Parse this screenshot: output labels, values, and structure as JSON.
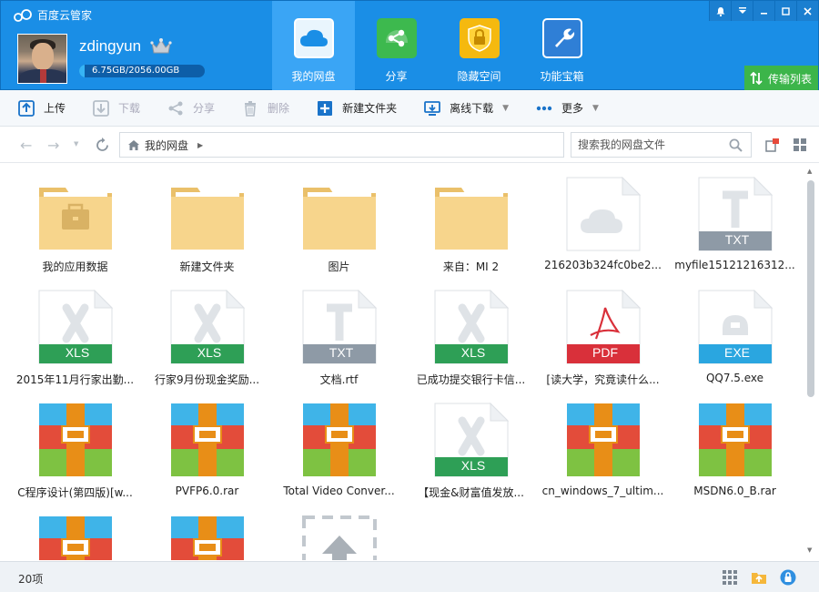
{
  "app": {
    "title": "百度云管家"
  },
  "user": {
    "name": "zdingyun",
    "quota_text": "6.75GB/2056.00GB",
    "quota_fraction": 0.0033
  },
  "nav": [
    {
      "id": "mydisk",
      "label": "我的网盘",
      "active": true
    },
    {
      "id": "share",
      "label": "分享",
      "active": false
    },
    {
      "id": "hidden",
      "label": "隐藏空间",
      "active": false
    },
    {
      "id": "tools",
      "label": "功能宝箱",
      "active": false
    }
  ],
  "transfer": {
    "label": "传输列表"
  },
  "toolbar": {
    "upload": "上传",
    "download": "下载",
    "share": "分享",
    "delete": "删除",
    "new_folder": "新建文件夹",
    "offline_download": "离线下载",
    "more": "更多"
  },
  "address": {
    "path": "我的网盘"
  },
  "search": {
    "placeholder": "搜索我的网盘文件"
  },
  "files": [
    {
      "name": "我的应用数据",
      "type": "folder-app"
    },
    {
      "name": "新建文件夹",
      "type": "folder"
    },
    {
      "name": "图片",
      "type": "folder"
    },
    {
      "name": "来自：MI 2",
      "type": "folder"
    },
    {
      "name": "216203b324fc0be2...",
      "type": "cloud"
    },
    {
      "name": "myfile15121216312...",
      "type": "doc",
      "badge": "TXT"
    },
    {
      "name": "2015年11月行家出勤...",
      "type": "doc",
      "badge": "XLS"
    },
    {
      "name": "行家9月份现金奖励...",
      "type": "doc",
      "badge": "XLS"
    },
    {
      "name": "文档.rtf",
      "type": "doc",
      "badge": "TXT"
    },
    {
      "name": "已成功提交银行卡信...",
      "type": "doc",
      "badge": "XLS"
    },
    {
      "name": "[读大学，究竟读什么...",
      "type": "doc",
      "badge": "PDF"
    },
    {
      "name": "QQ7.5.exe",
      "type": "doc",
      "badge": "EXE"
    },
    {
      "name": "C程序设计(第四版)[w...",
      "type": "rar"
    },
    {
      "name": "PVFP6.0.rar",
      "type": "rar"
    },
    {
      "name": "Total Video Conver...",
      "type": "rar"
    },
    {
      "name": "【现金&财富值发放...",
      "type": "doc",
      "badge": "XLS"
    },
    {
      "name": "cn_windows_7_ultim...",
      "type": "rar"
    },
    {
      "name": "MSDN6.0_B.rar",
      "type": "rar"
    },
    {
      "name": "",
      "type": "rar"
    },
    {
      "name": "",
      "type": "rar"
    },
    {
      "name": "",
      "type": "upload"
    }
  ],
  "status": {
    "count": "20项"
  },
  "colors": {
    "header_bg": "#1a8ee6",
    "nav_active": "#3aa5f5",
    "transfer_bg": "#3cb54a",
    "folder": "#f7d58c",
    "xls": "#2e9f56",
    "txt": "#8e9aa6",
    "pdf": "#d9303a",
    "exe": "#2aa6e0"
  }
}
